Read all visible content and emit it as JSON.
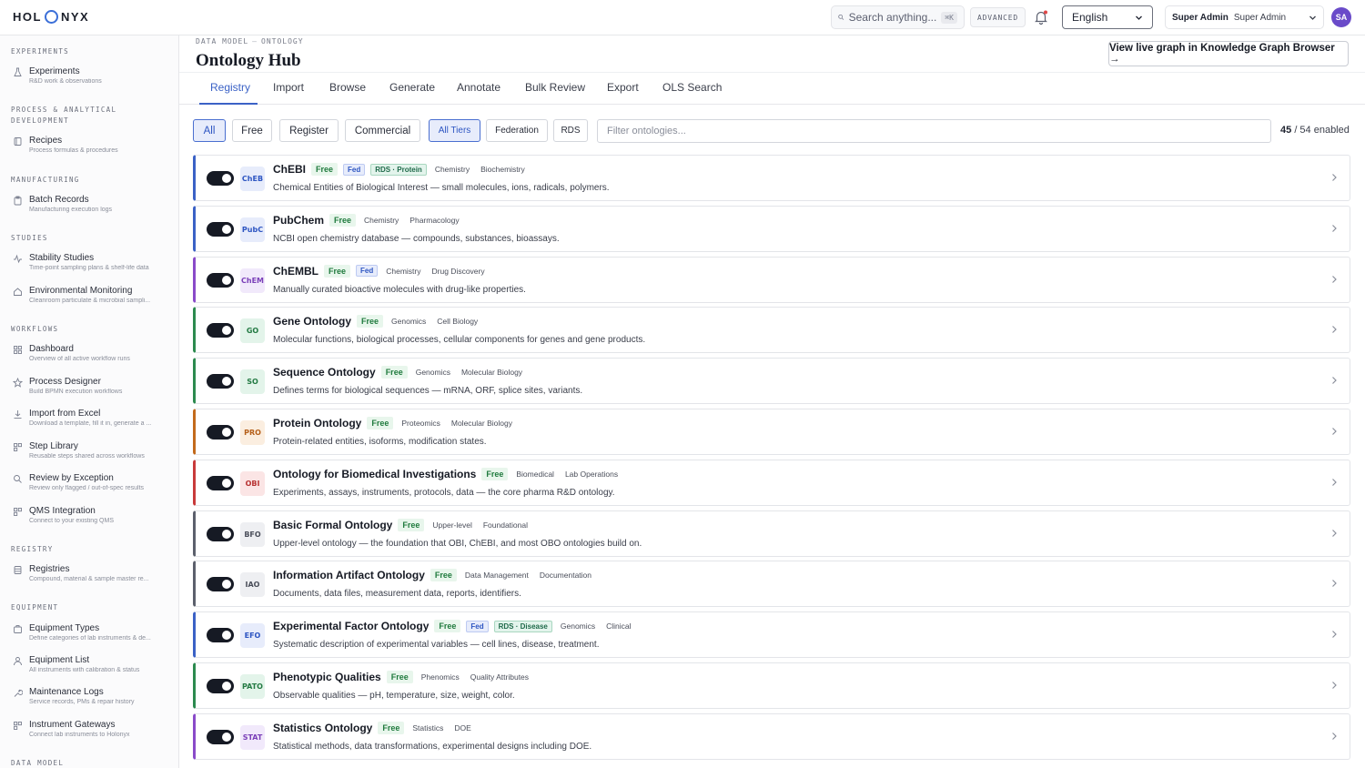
{
  "app": {
    "logo": {
      "left": "HOL",
      "right": "NYX"
    },
    "search_placeholder": "Search anything...",
    "search_shortcut": "⌘K",
    "advanced_label": "ADVANCED",
    "language": "English",
    "role_label": "Super Admin",
    "role_value": "Super Admin",
    "avatar_initials": "SA"
  },
  "sidebar": {
    "sections": [
      {
        "title": "EXPERIMENTS",
        "items": [
          {
            "label": "Experiments",
            "desc": "R&D work & observations",
            "icon": "flask-icon"
          }
        ]
      },
      {
        "title": "PROCESS & ANALYTICAL DEVELOPMENT",
        "items": [
          {
            "label": "Recipes",
            "desc": "Process formulas & procedures",
            "icon": "book-icon"
          }
        ]
      },
      {
        "title": "MANUFACTURING",
        "items": [
          {
            "label": "Batch Records",
            "desc": "Manufacturing execution logs",
            "icon": "clipboard-icon"
          }
        ]
      },
      {
        "title": "STUDIES",
        "items": [
          {
            "label": "Stability Studies",
            "desc": "Time-point sampling plans & shelf-life data",
            "icon": "activity-icon"
          },
          {
            "label": "Environmental Monitoring",
            "desc": "Cleanroom particulate & microbial sampli...",
            "icon": "home-icon"
          }
        ]
      },
      {
        "title": "WORKFLOWS",
        "items": [
          {
            "label": "Dashboard",
            "desc": "Overview of all active workflow runs",
            "icon": "grid-icon"
          },
          {
            "label": "Process Designer",
            "desc": "Build BPMN execution workflows",
            "icon": "star-icon"
          },
          {
            "label": "Import from Excel",
            "desc": "Download a template, fill it in, generate a ...",
            "icon": "download-icon"
          },
          {
            "label": "Step Library",
            "desc": "Reusable steps shared across workflows",
            "icon": "blocks-icon"
          },
          {
            "label": "Review by Exception",
            "desc": "Review only flagged / out-of-spec results",
            "icon": "search-icon"
          },
          {
            "label": "QMS Integration",
            "desc": "Connect to your existing QMS",
            "icon": "blocks-icon"
          }
        ]
      },
      {
        "title": "REGISTRY",
        "items": [
          {
            "label": "Registries",
            "desc": "Compound, material & sample master re...",
            "icon": "database-icon"
          }
        ]
      },
      {
        "title": "EQUIPMENT",
        "items": [
          {
            "label": "Equipment Types",
            "desc": "Define categories of lab instruments & de...",
            "icon": "briefcase-icon"
          },
          {
            "label": "Equipment List",
            "desc": "All instruments with calibration & status",
            "icon": "user-icon"
          },
          {
            "label": "Maintenance Logs",
            "desc": "Service records, PMs & repair history",
            "icon": "wrench-icon"
          },
          {
            "label": "Instrument Gateways",
            "desc": "Connect lab instruments to Holonyx",
            "icon": "blocks-icon"
          }
        ]
      },
      {
        "title": "DATA MODEL",
        "items": []
      }
    ]
  },
  "page": {
    "breadcrumb": [
      "DATA MODEL",
      "ONTOLOGY"
    ],
    "breadcrumb_sep": "—",
    "title": "Ontology Hub",
    "graph_button": "View live graph in Knowledge Graph Browser →",
    "tabs": [
      "Registry",
      "Import",
      "Browse",
      "Generate",
      "Annotate",
      "Bulk Review",
      "Export",
      "OLS Search"
    ],
    "active_tab": "Registry",
    "license_filters": [
      "All",
      "Free",
      "Register",
      "Commercial"
    ],
    "tier_filters": [
      "All Tiers",
      "Federation",
      "RDS"
    ],
    "filter_placeholder": "Filter ontologies...",
    "enabled_count": "45",
    "total_count": "/ 54 enabled"
  },
  "ontologies": [
    {
      "abbr": "ChEB",
      "name": "ChEBI",
      "free": "Free",
      "fed": "Fed",
      "rds": "RDS · Protein",
      "cats": [
        "Chemistry",
        "Biochemistry"
      ],
      "desc": "Chemical Entities of Biological Interest — small molecules, ions, radicals, polymers.",
      "accent": "#3b62c6",
      "badge_bg": "#e7ecfb",
      "badge_fg": "#2d55c2"
    },
    {
      "abbr": "PubC",
      "name": "PubChem",
      "free": "Free",
      "fed": "",
      "rds": "",
      "cats": [
        "Chemistry",
        "Pharmacology"
      ],
      "desc": "NCBI open chemistry database — compounds, substances, bioassays.",
      "accent": "#3b62c6",
      "badge_bg": "#e7ecfb",
      "badge_fg": "#2d55c2"
    },
    {
      "abbr": "ChEM",
      "name": "ChEMBL",
      "free": "Free",
      "fed": "Fed",
      "rds": "",
      "cats": [
        "Chemistry",
        "Drug Discovery"
      ],
      "desc": "Manually curated bioactive molecules with drug-like properties.",
      "accent": "#8a4bc9",
      "badge_bg": "#f1e9fb",
      "badge_fg": "#7a3fb8"
    },
    {
      "abbr": "GO",
      "name": "Gene Ontology",
      "free": "Free",
      "fed": "",
      "rds": "",
      "cats": [
        "Genomics",
        "Cell Biology"
      ],
      "desc": "Molecular functions, biological processes, cellular components for genes and gene products.",
      "accent": "#2c8a4f",
      "badge_bg": "#e3f4ea",
      "badge_fg": "#237a43"
    },
    {
      "abbr": "SO",
      "name": "Sequence Ontology",
      "free": "Free",
      "fed": "",
      "rds": "",
      "cats": [
        "Genomics",
        "Molecular Biology"
      ],
      "desc": "Defines terms for biological sequences — mRNA, ORF, splice sites, variants.",
      "accent": "#2c8a4f",
      "badge_bg": "#e3f4ea",
      "badge_fg": "#237a43"
    },
    {
      "abbr": "PRO",
      "name": "Protein Ontology",
      "free": "Free",
      "fed": "",
      "rds": "",
      "cats": [
        "Proteomics",
        "Molecular Biology"
      ],
      "desc": "Protein-related entities, isoforms, modification states.",
      "accent": "#c36a1c",
      "badge_bg": "#fbeee0",
      "badge_fg": "#b5601a"
    },
    {
      "abbr": "OBI",
      "name": "Ontology for Biomedical Investigations",
      "free": "Free",
      "fed": "",
      "rds": "",
      "cats": [
        "Biomedical",
        "Lab Operations"
      ],
      "desc": "Experiments, assays, instruments, protocols, data — the core pharma R&D ontology.",
      "accent": "#c83a3a",
      "badge_bg": "#fbe5e5",
      "badge_fg": "#b83232"
    },
    {
      "abbr": "BFO",
      "name": "Basic Formal Ontology",
      "free": "Free",
      "fed": "",
      "rds": "",
      "cats": [
        "Upper-level",
        "Foundational"
      ],
      "desc": "Upper-level ontology — the foundation that OBI, ChEBI, and most OBO ontologies build on.",
      "accent": "#5c606c",
      "badge_bg": "#eeeff2",
      "badge_fg": "#4a4e5a"
    },
    {
      "abbr": "IAO",
      "name": "Information Artifact Ontology",
      "free": "Free",
      "fed": "",
      "rds": "",
      "cats": [
        "Data Management",
        "Documentation"
      ],
      "desc": "Documents, data files, measurement data, reports, identifiers.",
      "accent": "#5c606c",
      "badge_bg": "#eeeff2",
      "badge_fg": "#4a4e5a"
    },
    {
      "abbr": "EFO",
      "name": "Experimental Factor Ontology",
      "free": "Free",
      "fed": "Fed",
      "rds": "RDS · Disease",
      "cats": [
        "Genomics",
        "Clinical"
      ],
      "desc": "Systematic description of experimental variables — cell lines, disease, treatment.",
      "accent": "#3b62c6",
      "badge_bg": "#e7ecfb",
      "badge_fg": "#2d55c2"
    },
    {
      "abbr": "PATO",
      "name": "Phenotypic Qualities",
      "free": "Free",
      "fed": "",
      "rds": "",
      "cats": [
        "Phenomics",
        "Quality Attributes"
      ],
      "desc": "Observable qualities — pH, temperature, size, weight, color.",
      "accent": "#2c8a4f",
      "badge_bg": "#e3f4ea",
      "badge_fg": "#237a43"
    },
    {
      "abbr": "STAT",
      "name": "Statistics Ontology",
      "free": "Free",
      "fed": "",
      "rds": "",
      "cats": [
        "Statistics",
        "DOE"
      ],
      "desc": "Statistical methods, data transformations, experimental designs including DOE.",
      "accent": "#8a4bc9",
      "badge_bg": "#f1e9fb",
      "badge_fg": "#7a3fb8"
    }
  ]
}
